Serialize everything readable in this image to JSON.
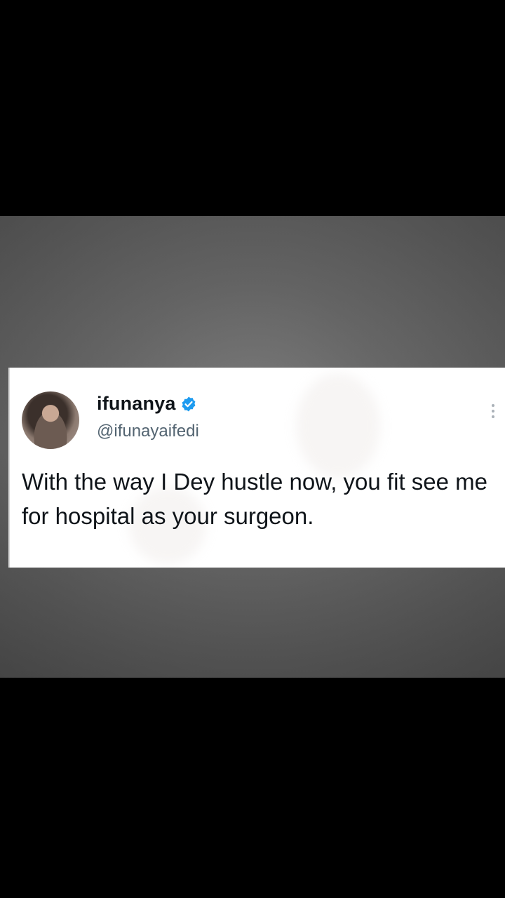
{
  "tweet": {
    "display_name": "ifunanya",
    "handle": "@ifunayaifedi",
    "verified": true,
    "text": "With the way I Dey hustle now, you fit see me for hospital as your surgeon.",
    "icons": {
      "verified": "verified-badge-icon",
      "more": "more-options-icon"
    }
  },
  "colors": {
    "background": "#000000",
    "photo": "#6a6a6a",
    "card": "#ffffff",
    "text": "#0f1419",
    "muted": "#536471",
    "verified": "#1d9bf0"
  }
}
